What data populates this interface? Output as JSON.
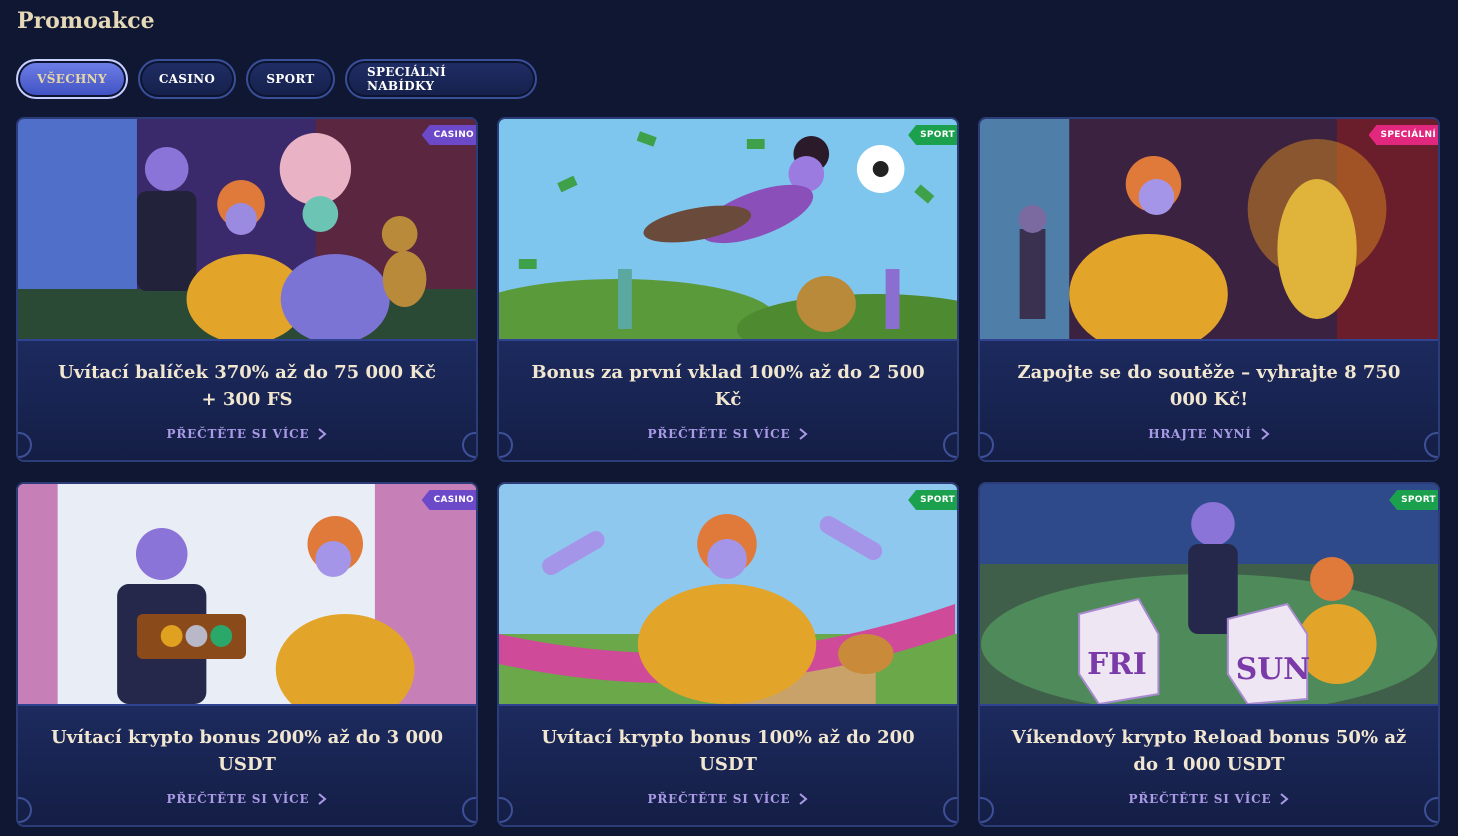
{
  "page": {
    "title": "Promoakce"
  },
  "tabs": [
    {
      "label": "VŠECHNY",
      "active": true
    },
    {
      "label": "CASINO",
      "active": false
    },
    {
      "label": "SPORT",
      "active": false
    },
    {
      "label": "SPECIÁLNÍ NABÍDKY",
      "active": false
    }
  ],
  "colors": {
    "background": "#0f1733",
    "card": "#18244f",
    "link": "#a99ae6",
    "casino_tag": "#6b49c8",
    "sport_tag": "#1ba14d",
    "special_tag": "#e2277f"
  },
  "promos": [
    {
      "tag": "CASINO",
      "title": "Uvítací balíček 370% až do 75 000 Kč + 300 FS",
      "link": "PŘEČTĚTE SI VÍCE",
      "icon": "chevron-right-icon"
    },
    {
      "tag": "SPORT",
      "title": "Bonus za první vklad 100% až do 2 500 Kč",
      "link": "PŘEČTĚTE SI VÍCE",
      "icon": "chevron-right-icon"
    },
    {
      "tag": "SPECIÁLNÍ",
      "title": "Zapojte se do soutěže – vyhrajte 8 750 000 Kč!",
      "link": "HRAJTE NYNÍ",
      "icon": "chevron-right-icon"
    },
    {
      "tag": "CASINO",
      "title": "Uvítací krypto bonus 200% až do 3 000 USDT",
      "link": "PŘEČTĚTE SI VÍCE",
      "icon": "chevron-right-icon"
    },
    {
      "tag": "SPORT",
      "title": "Uvítací krypto bonus 100% až do 200 USDT",
      "link": "PŘEČTĚTE SI VÍCE",
      "icon": "chevron-right-icon"
    },
    {
      "tag": "SPORT",
      "title": "Víkendový krypto Reload bonus 50% až do 1 000 USDT",
      "link": "PŘEČTĚTE SI VÍCE",
      "icon": "chevron-right-icon"
    }
  ],
  "scene_text": {
    "die_left": "FRI",
    "die_right": "SUN"
  }
}
